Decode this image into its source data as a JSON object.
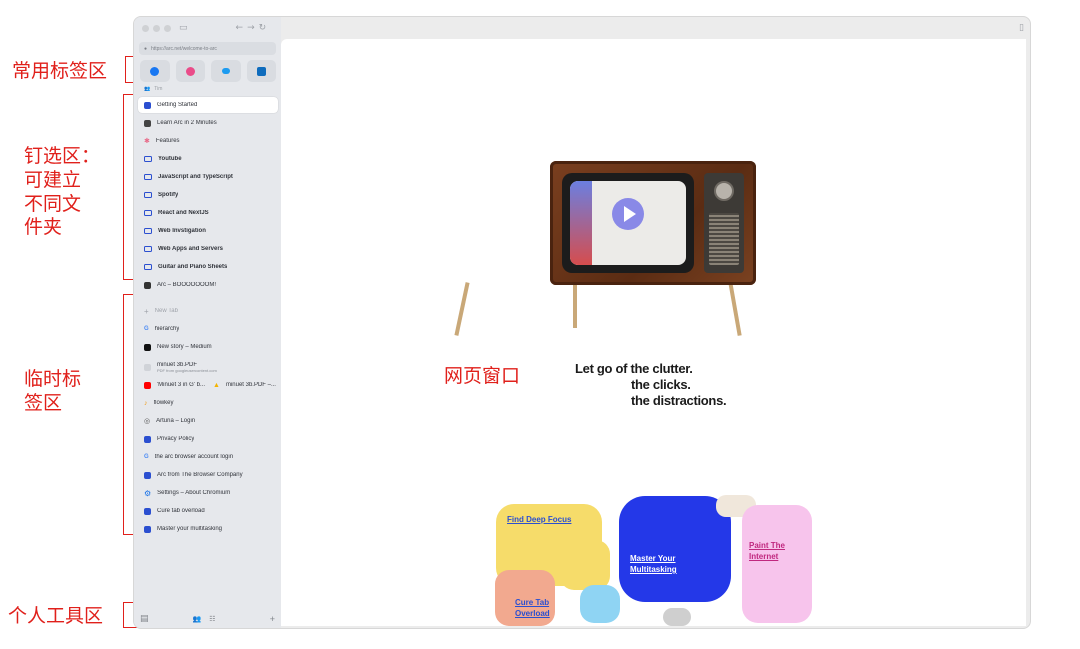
{
  "annotations": {
    "favorites": "常用标签区",
    "pinned": [
      "钉选区：",
      "可建立",
      "不同文",
      "件夹"
    ],
    "temporary": [
      "临时标",
      "签区"
    ],
    "tools": "个人工具区",
    "web_window": "网页窗口"
  },
  "browser": {
    "url": "https://arc.net/welcome-to-arc",
    "favorites": [
      {
        "name": "facebook-icon",
        "color": "#1877f2"
      },
      {
        "name": "dribbble-icon",
        "color": "#ea4c89"
      },
      {
        "name": "twitter-icon",
        "color": "#1d9bf0"
      },
      {
        "name": "outlook-icon",
        "color": "#0f6cbd"
      }
    ],
    "space_label": "Tim",
    "pinned": [
      {
        "label": "Getting Started",
        "icon": "arc-icon",
        "color": "#2b4fd0",
        "active": true
      },
      {
        "label": "Learn Arc in 2 Minutes",
        "icon": "video-icon",
        "color": "#444444"
      },
      {
        "label": "Features",
        "icon": "star-icon",
        "color": "#e86a88"
      },
      {
        "label": "Youtube",
        "icon": "folder-icon"
      },
      {
        "label": "JavaScript and TypeScript",
        "icon": "folder-icon"
      },
      {
        "label": "Spotify",
        "icon": "folder-icon"
      },
      {
        "label": "React and NextJS",
        "icon": "folder-icon"
      },
      {
        "label": "Web Invstigation",
        "icon": "folder-icon"
      },
      {
        "label": "Web Apps and Servers",
        "icon": "folder-icon"
      },
      {
        "label": "Guitar and Piano Sheets",
        "icon": "folder-icon"
      },
      {
        "label": "Arc – BOOOOOOOM!",
        "icon": "page-icon",
        "color": "#333333"
      }
    ],
    "new_tab": "New Tab",
    "tabs": [
      {
        "label": "hierarchy",
        "icon": "google-icon"
      },
      {
        "label": "New story – Medium",
        "icon": "medium-icon",
        "color": "#111111"
      },
      {
        "label": "minuet 3b.PDF",
        "sub": "PDF from googleusercontent.com",
        "icon": "pdf-icon",
        "color": "#9aa0a6"
      },
      {
        "label": "'Minuet 3 in G' b...",
        "label2": "minuet 3b.PDF –...",
        "icon": "youtube-icon",
        "color": "#ff0000"
      },
      {
        "label": "flowkey",
        "icon": "flowkey-icon",
        "color": "#f0a020"
      },
      {
        "label": "Arturia – Login",
        "icon": "arturia-icon",
        "color": "#555555"
      },
      {
        "label": "Privacy Policy",
        "icon": "arc-icon",
        "color": "#2b4fd0"
      },
      {
        "label": "the arc browser account login",
        "icon": "google-icon"
      },
      {
        "label": "Arc from The Browser Company",
        "icon": "arc-icon",
        "color": "#2b4fd0"
      },
      {
        "label": "Settings – About Chromium",
        "icon": "gear-icon",
        "color": "#1a73e8"
      },
      {
        "label": "Cure tab overload",
        "icon": "arc-icon",
        "color": "#2b4fd0"
      },
      {
        "label": "Master your multitasking",
        "icon": "arc-icon",
        "color": "#2b4fd0"
      }
    ]
  },
  "page": {
    "headline": [
      "Let go of the clutter.",
      "the clicks.",
      "the distractions."
    ],
    "tiles": [
      "Find Deep Focus",
      "Master Your Multitasking",
      "Paint The Internet",
      "Cure Tab Overload"
    ]
  }
}
